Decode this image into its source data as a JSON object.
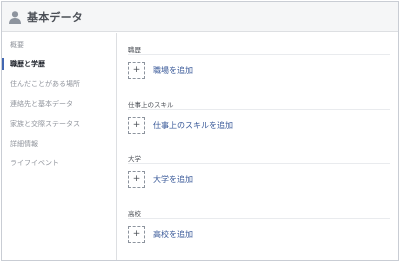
{
  "header": {
    "title": "基本データ",
    "icon": "person-icon"
  },
  "sidebar": {
    "items": [
      {
        "label": "概要",
        "active": false
      },
      {
        "label": "職歴と学歴",
        "active": true
      },
      {
        "label": "住んだことがある場所",
        "active": false
      },
      {
        "label": "連絡先と基本データ",
        "active": false
      },
      {
        "label": "家族と交際ステータス",
        "active": false
      },
      {
        "label": "詳細情報",
        "active": false
      },
      {
        "label": "ライフイベント",
        "active": false
      }
    ]
  },
  "main": {
    "sections": [
      {
        "heading": "職歴",
        "add_label": "職場を追加"
      },
      {
        "heading": "仕事上のスキル",
        "add_label": "仕事上のスキルを追加"
      },
      {
        "heading": "大学",
        "add_label": "大学を追加"
      },
      {
        "heading": "高校",
        "add_label": "高校を追加"
      }
    ],
    "plus_symbol": "+"
  },
  "colors": {
    "accent": "#4267b2",
    "link": "#385898",
    "muted_text": "#90949c",
    "header_bg": "#f5f6f7",
    "divider": "#dddfe2"
  }
}
